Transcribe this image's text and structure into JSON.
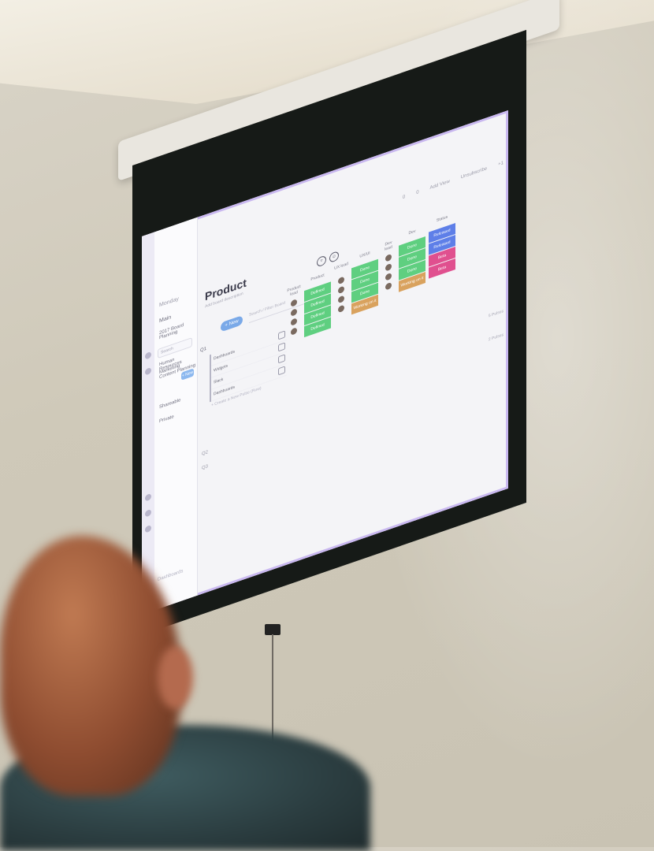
{
  "app": {
    "sidebar": {
      "title": "Monday",
      "workspace": "Main",
      "items": [
        "2017 Board Planning",
        "Human Resources",
        "Marketing Content Planning"
      ],
      "search_placeholder": "Search",
      "new_label": "+ New",
      "sections": [
        "Shareable",
        "Private"
      ]
    },
    "topbar": {
      "items": [
        "0",
        "0",
        "Add View",
        "Unsubscribe",
        "+1"
      ]
    },
    "board": {
      "title": "Product",
      "subtitle": "Add board description",
      "new_button": "+ New",
      "search_placeholder": "Search / Filter Board",
      "group_title": "Q1",
      "rows": [
        "Dashboards",
        "Widgets",
        "Slack",
        "Dashboards"
      ],
      "add_row": "+ Create a New Pulse (Row)",
      "columns": [
        {
          "header": "Product lead",
          "kind": "avatar"
        },
        {
          "header": "Product",
          "kind": "status",
          "cells": [
            {
              "label": "Defined",
              "color": "#5fcf80"
            },
            {
              "label": "Defined",
              "color": "#5fcf80"
            },
            {
              "label": "Defined",
              "color": "#5fcf80"
            },
            {
              "label": "Defined",
              "color": "#5fcf80"
            }
          ]
        },
        {
          "header": "UX lead",
          "kind": "avatar"
        },
        {
          "header": "UX/UI",
          "kind": "status",
          "cells": [
            {
              "label": "Done",
              "color": "#5fcf80"
            },
            {
              "label": "Done",
              "color": "#5fcf80"
            },
            {
              "label": "Done",
              "color": "#5fcf80"
            },
            {
              "label": "Working on it",
              "color": "#d9a25e"
            }
          ]
        },
        {
          "header": "Dev lead",
          "kind": "avatar"
        },
        {
          "header": "Dev",
          "kind": "status",
          "cells": [
            {
              "label": "Done",
              "color": "#5fcf80"
            },
            {
              "label": "Done",
              "color": "#5fcf80"
            },
            {
              "label": "Done",
              "color": "#5fcf80"
            },
            {
              "label": "Working on it",
              "color": "#d9a25e"
            }
          ]
        },
        {
          "header": "Status",
          "kind": "status",
          "cells": [
            {
              "label": "Released",
              "color": "#5e7fe8"
            },
            {
              "label": "Released",
              "color": "#5e7fe8"
            },
            {
              "label": "Beta",
              "color": "#e0508f"
            },
            {
              "label": "Beta",
              "color": "#e0508f"
            }
          ]
        }
      ],
      "pulse_counts": [
        "5 Pulses",
        "2 Pulses"
      ],
      "other_groups": [
        "Q2",
        "Q3"
      ],
      "footer": "Dashboards"
    }
  }
}
